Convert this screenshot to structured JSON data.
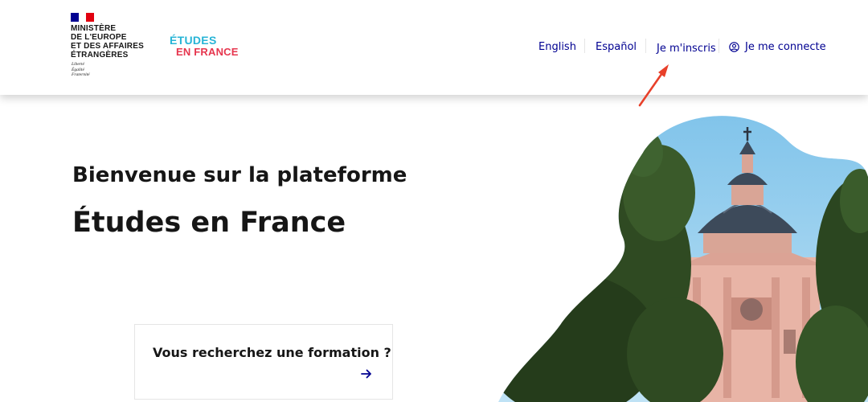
{
  "header": {
    "ministry_lines": [
      "MINISTÈRE",
      "DE L'EUROPE",
      "ET DES AFFAIRES",
      "ÉTRANGÈRES"
    ],
    "devise_lines": [
      "Liberté",
      "Égalité",
      "Fraternité"
    ],
    "logo": {
      "line1": "ÉTUDES",
      "line2": "EN FRANCE"
    }
  },
  "nav": {
    "english": "English",
    "espanol": "Español",
    "inscris": "Je m'inscris",
    "connect": "Je me connecte",
    "user_icon": "user-circle-icon"
  },
  "hero": {
    "welcome": "Bienvenue sur la plateforme",
    "title": "Études en France"
  },
  "card": {
    "title": "Vous recherchez une formation ?",
    "arrow_icon": "arrow-right-icon"
  },
  "colors": {
    "primary": "#000091",
    "logo_blue": "#27b4d6",
    "logo_red": "#e6364e",
    "annotation_arrow": "#e8402a"
  }
}
